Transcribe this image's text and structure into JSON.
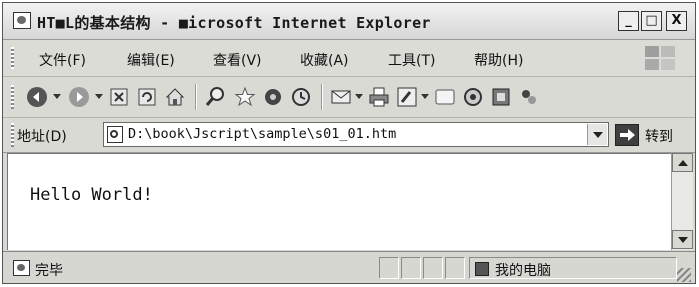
{
  "window": {
    "title": "HT■L的基本结构 - ■icrosoft Internet Explorer",
    "minimize_label": "_",
    "maximize_label": "□",
    "close_label": "X"
  },
  "menu": {
    "items": [
      {
        "label": "文件(F)"
      },
      {
        "label": "编辑(E)"
      },
      {
        "label": "查看(V)"
      },
      {
        "label": "收藏(A)"
      },
      {
        "label": "工具(T)"
      },
      {
        "label": "帮助(H)"
      }
    ]
  },
  "toolbar": {
    "icons": [
      "back-icon",
      "forward-icon",
      "stop-icon",
      "refresh-icon",
      "home-icon",
      "search-icon",
      "favorites-icon",
      "media-icon",
      "history-icon",
      "mail-icon",
      "print-icon",
      "edit-icon",
      "discuss-icon",
      "research-icon",
      "messenger-icon",
      "extra-icon"
    ]
  },
  "address": {
    "label": "地址(D)",
    "url": "D:\\book\\Jscript\\sample\\s01_01.htm",
    "go_label": "转到"
  },
  "content": {
    "text": "Hello World!"
  },
  "status": {
    "text": "完毕",
    "zone": "我的电脑"
  }
}
